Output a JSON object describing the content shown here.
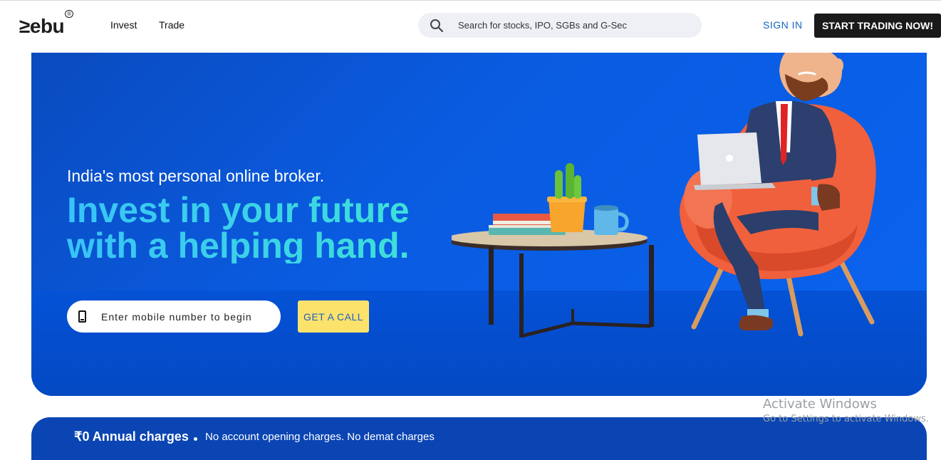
{
  "header": {
    "logo_text": "≥ebu",
    "logo_mark": "®",
    "nav": {
      "invest": "Invest",
      "trade": "Trade"
    },
    "search_placeholder": "Search for stocks, IPO, SGBs and G-Sec",
    "signin": "SIGN IN",
    "start_trading": "START TRADING NOW!"
  },
  "hero": {
    "tagline": "India's most personal online broker.",
    "headline_line1": "Invest in your future",
    "headline_line2": "with a helping hand.",
    "mobile_placeholder": "Enter mobile number to begin",
    "call_button": "GET A CALL"
  },
  "strip": {
    "annual_charges": "₹0 Annual charges",
    "no_charges": "No account opening charges. No demat charges"
  },
  "watermark": {
    "line1": "Activate Windows",
    "line2": "Go to Settings to activate Windows."
  },
  "icons": {
    "search": "search-icon",
    "phone": "mobile-phone-icon"
  },
  "colors": {
    "hero_blue": "#0a5be0",
    "headline_cyan": "#38c3f8",
    "call_yellow": "#fbe36b",
    "signin_blue": "#1565c0",
    "cta_dark": "#1a1a1a"
  }
}
